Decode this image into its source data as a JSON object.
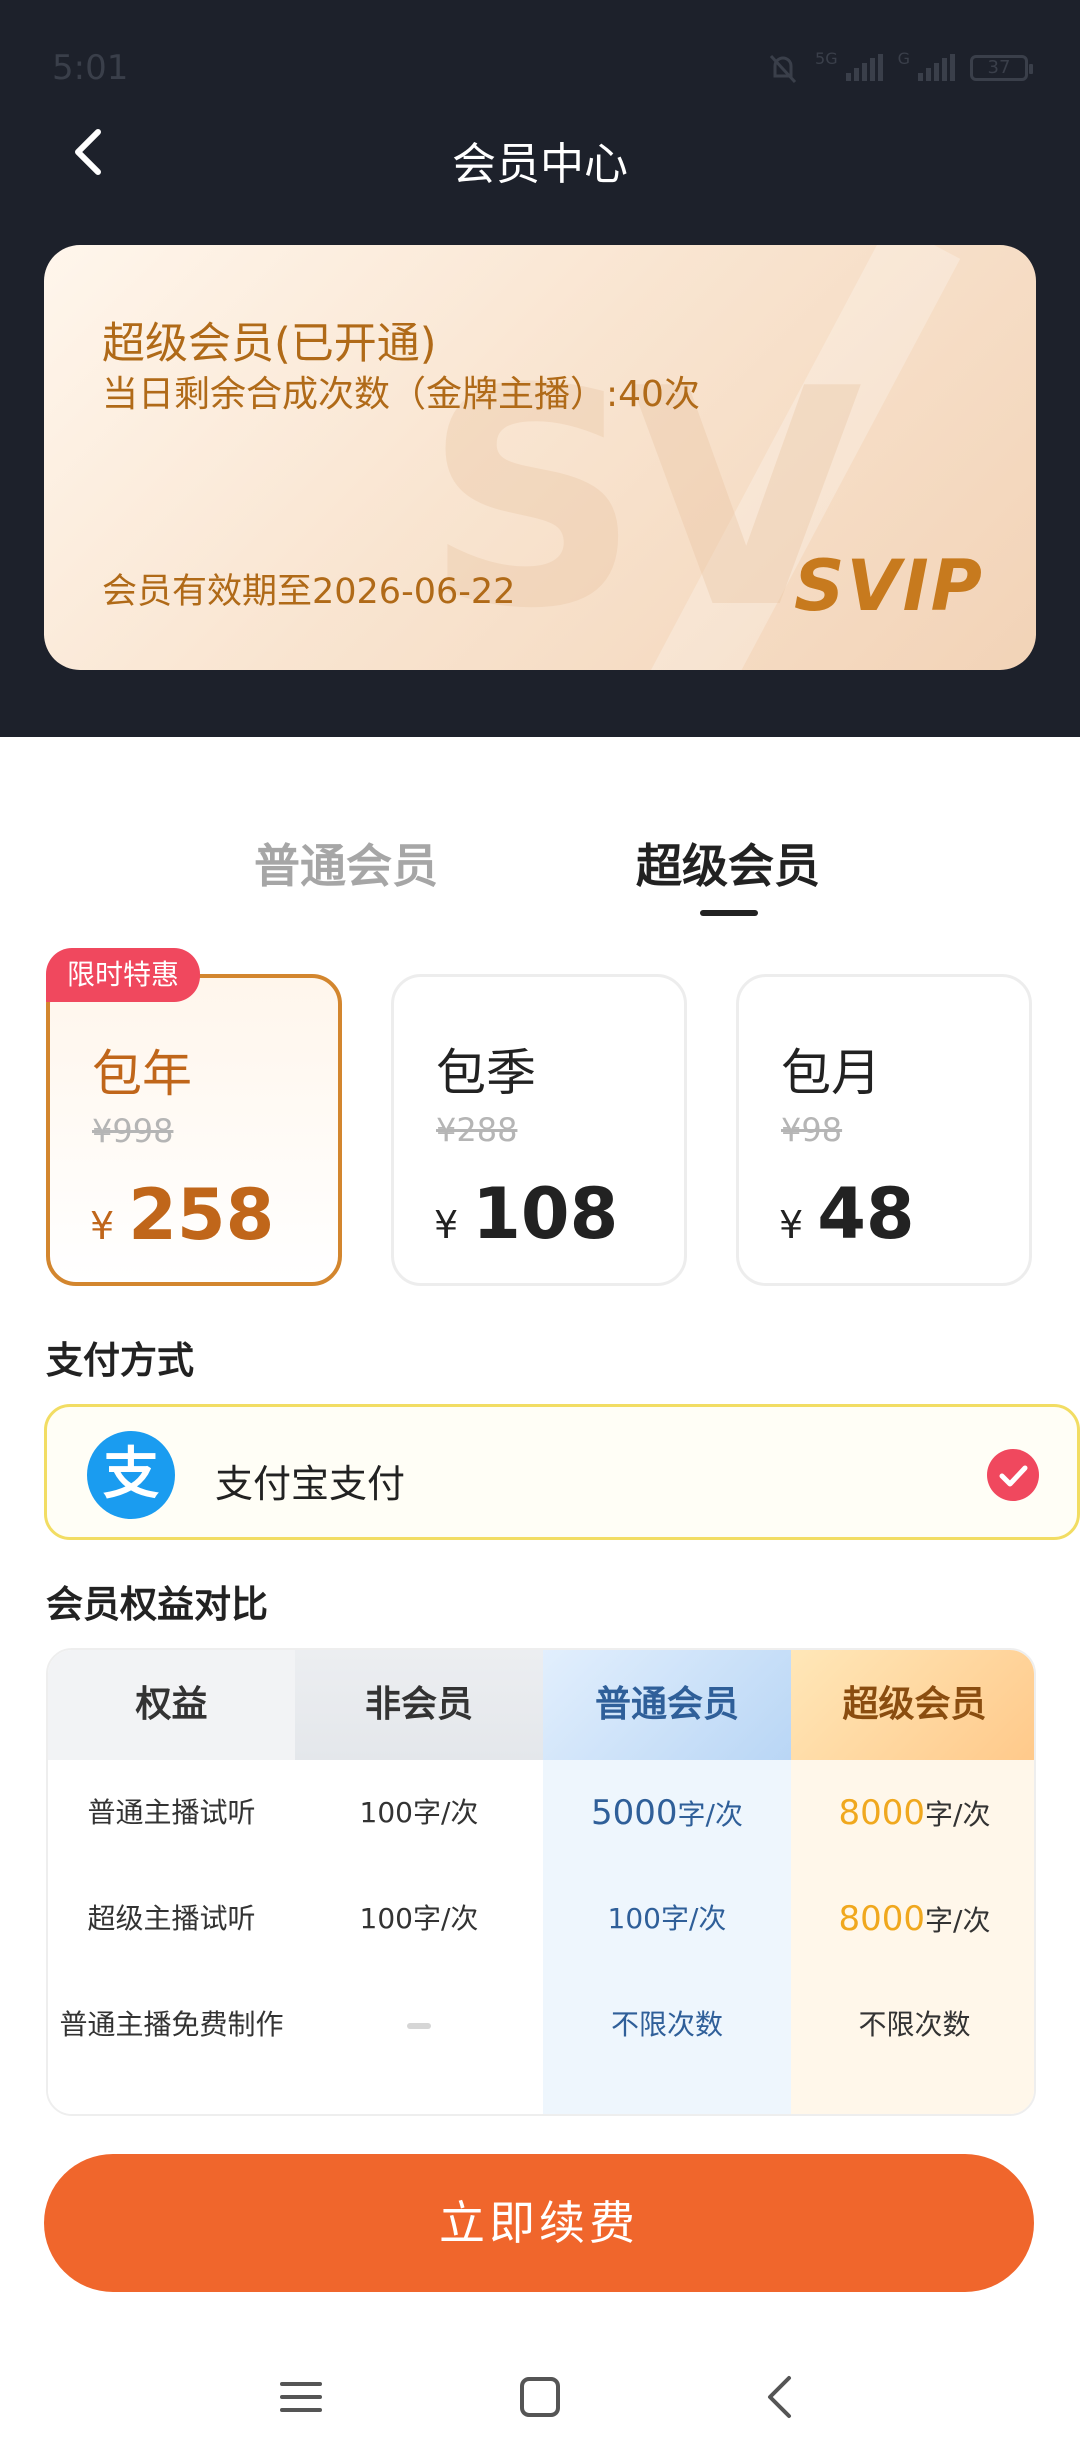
{
  "status_bar": {
    "time": "5:01",
    "network_1": "5G",
    "network_2": "G",
    "battery": "37"
  },
  "header": {
    "title": "会员中心"
  },
  "vip_card": {
    "title": "超级会员(已开通)",
    "quota": "当日剩余合成次数（金牌主播）:40次",
    "expire": "会员有效期至2026-06-22",
    "logo_text": "SVIP",
    "watermark": "SV"
  },
  "tabs": [
    {
      "label": "普通会员",
      "active": false
    },
    {
      "label": "超级会员",
      "active": true
    }
  ],
  "plans": {
    "badge": "限时特惠",
    "items": [
      {
        "name": "包年",
        "original": "¥998",
        "currency": "¥",
        "price": "258",
        "selected": true
      },
      {
        "name": "包季",
        "original": "¥288",
        "currency": "¥",
        "price": "108",
        "selected": false
      },
      {
        "name": "包月",
        "original": "¥98",
        "currency": "¥",
        "price": "48",
        "selected": false
      }
    ]
  },
  "payment": {
    "title": "支付方式",
    "method": "支付宝支付",
    "icon_glyph": "支",
    "selected": true
  },
  "compare": {
    "title": "会员权益对比",
    "headers": [
      "权益",
      "非会员",
      "普通会员",
      "超级会员"
    ],
    "rows": [
      {
        "benefit": "普通主播试听",
        "free": "100字/次",
        "normal_num": "5000",
        "normal_unit": "字/次",
        "super_num": "8000",
        "super_unit": "字/次"
      },
      {
        "benefit": "超级主播试听",
        "free": "100字/次",
        "normal_num": "",
        "normal_unit": "100字/次",
        "super_num": "8000",
        "super_unit": "字/次"
      },
      {
        "benefit": "普通主播免费制作",
        "free": "",
        "normal_num": "",
        "normal_unit": "不限次数",
        "super_num": "",
        "super_unit": "不限次数"
      }
    ]
  },
  "renew_button": "立即续费",
  "colors": {
    "header_bg": "#1d212b",
    "accent_orange": "#f0662c",
    "gold_text": "#b06a18",
    "badge_red": "#f0485e",
    "alipay_blue": "#1a9cf0"
  }
}
